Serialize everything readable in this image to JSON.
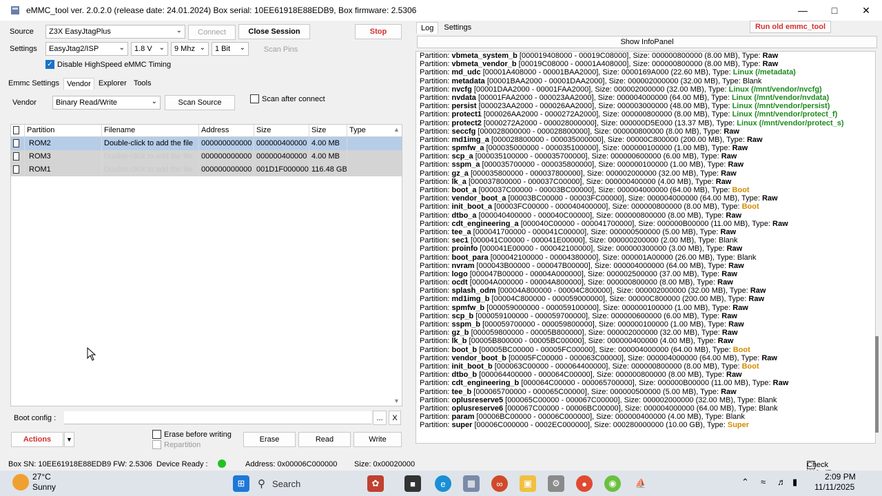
{
  "window": {
    "title": "eMMC_tool ver. 2.0.2.0 (release date: 24.01.2024) Box serial: 10EE61918E88EDB9, Box firmware: 2.5306"
  },
  "top": {
    "source_label": "Source",
    "source_value": "Z3X EasyJtagPlus",
    "connect": "Connect",
    "close_session": "Close Session",
    "stop": "Stop",
    "settings_label": "Settings",
    "settings_value": "EasyJtag2/ISP",
    "voltage": "1.8 V",
    "clock": "9 Mhz",
    "bus": "1 Bit",
    "scan_pins": "Scan Pins",
    "disable_hs": "Disable HighSpeed eMMC Timing"
  },
  "tabs": [
    "Emmc Settings",
    "Vendor",
    "Explorer",
    "Tools"
  ],
  "vendor": {
    "label": "Vendor",
    "value": "Binary Read/Write",
    "scan_source": "Scan Source",
    "scan_after": "Scan after connect"
  },
  "grid": {
    "headers": [
      "Partition",
      "Filename",
      "Address",
      "Size",
      "Size",
      "Type"
    ],
    "rows": [
      {
        "partition": "ROM2",
        "filename": "Double-click to add the file",
        "address": "000000000000",
        "size_hex": "000000400000",
        "size": "4.00 MB",
        "type": ""
      },
      {
        "partition": "ROM3",
        "filename": "Double-click to add the file",
        "address": "000000000000",
        "size_hex": "000000400000",
        "size": "4.00 MB",
        "type": ""
      },
      {
        "partition": "ROM1",
        "filename": "Double-click to add the file",
        "address": "000000000000",
        "size_hex": "001D1F000000",
        "size": "116.48 GB",
        "type": ""
      }
    ]
  },
  "boot": {
    "label": "Boot config  :",
    "browse": "...",
    "clear": "X"
  },
  "actions": {
    "actions": "Actions",
    "dropdown": "▼",
    "erase_before": "Erase before writing",
    "repartition": "Repartition",
    "erase": "Erase",
    "read": "Read",
    "write": "Write"
  },
  "right": {
    "tab_log": "Log",
    "tab_settings": "Settings",
    "run_old": "Run old emmc_tool",
    "show_info": "Show InfoPanel",
    "check_write": "Check Write/Erase"
  },
  "log_prefix": "Partition: ",
  "log": [
    {
      "name": "vbmeta_system_b",
      "range": "[000019408000 - 00019C08000]",
      "size": "000000800000 (8.00 MB)",
      "type": "Raw"
    },
    {
      "name": "vbmeta_vendor_b",
      "range": "[00019C08000 - 00001A408000]",
      "size": "000000800000 (8.00 MB)",
      "type": "Raw"
    },
    {
      "name": "md_udc",
      "range": "[00001A408000 - 00001BAA2000]",
      "size": "0000169A000 (22.60 MB)",
      "type": "Linux (/metadata)"
    },
    {
      "name": "metadata",
      "range": "[00001BAA2000 - 00001DAA2000]",
      "size": "000002000000 (32.00 MB)",
      "type": "Blank"
    },
    {
      "name": "nvcfg",
      "range": "[00001DAA2000 - 00001FAA2000]",
      "size": "000002000000 (32.00 MB)",
      "type": "Linux (/mnt/vendor/nvcfg)"
    },
    {
      "name": "nvdata",
      "range": "[00001FAA2000 - 000023AA2000]",
      "size": "000004000000 (64.00 MB)",
      "type": "Linux (/mnt/vendor/nvdata)"
    },
    {
      "name": "persist",
      "range": "[000023AA2000 - 000026AA2000]",
      "size": "000003000000 (48.00 MB)",
      "type": "Linux (/mnt/vendor/persist)"
    },
    {
      "name": "protect1",
      "range": "[000026AA2000 - 0000272A2000]",
      "size": "000000800000 (8.00 MB)",
      "type": "Linux (/mnt/vendor/protect_f)"
    },
    {
      "name": "protect2",
      "range": "[0000272A2000 - 000028000000]",
      "size": "000000D5E000 (13.37 MB)",
      "type": "Linux (/mnt/vendor/protect_s)"
    },
    {
      "name": "seccfg",
      "range": "[000028000000 - 000028800000]",
      "size": "000000800000 (8.00 MB)",
      "type": "Raw"
    },
    {
      "name": "md1img_a",
      "range": "[000028800000 - 000035000000]",
      "size": "00000C800000 (200.00 MB)",
      "type": "Raw"
    },
    {
      "name": "spmfw_a",
      "range": "[000035000000 - 000035100000]",
      "size": "000000100000 (1.00 MB)",
      "type": "Raw"
    },
    {
      "name": "scp_a",
      "range": "[000035100000 - 000035700000]",
      "size": "000000600000 (6.00 MB)",
      "type": "Raw"
    },
    {
      "name": "sspm_a",
      "range": "[000035700000 - 000035800000]",
      "size": "000000100000 (1.00 MB)",
      "type": "Raw"
    },
    {
      "name": "gz_a",
      "range": "[000035800000 - 000037800000]",
      "size": "000002000000 (32.00 MB)",
      "type": "Raw"
    },
    {
      "name": "lk_a",
      "range": "[000037800000 - 000037C00000]",
      "size": "000000400000 (4.00 MB)",
      "type": "Raw"
    },
    {
      "name": "boot_a",
      "range": "[000037C00000 - 00003BC00000]",
      "size": "000004000000 (64.00 MB)",
      "type": "Boot"
    },
    {
      "name": "vendor_boot_a",
      "range": "[00003BC00000 - 00003FC00000]",
      "size": "000004000000 (64.00 MB)",
      "type": "Raw"
    },
    {
      "name": "init_boot_a",
      "range": "[00003FC00000 - 000040400000]",
      "size": "000000800000 (8.00 MB)",
      "type": "Boot"
    },
    {
      "name": "dtbo_a",
      "range": "[000040400000 - 000040C00000]",
      "size": "000000800000 (8.00 MB)",
      "type": "Raw"
    },
    {
      "name": "cdt_engineering_a",
      "range": "[000040C00000 - 000041700000]",
      "size": "000000B00000 (11.00 MB)",
      "type": "Raw"
    },
    {
      "name": "tee_a",
      "range": "[000041700000 - 000041C00000]",
      "size": "000000500000 (5.00 MB)",
      "type": "Raw"
    },
    {
      "name": "sec1",
      "range": "[000041C00000 - 000041E00000]",
      "size": "000000200000 (2.00 MB)",
      "type": "Blank"
    },
    {
      "name": "proinfo",
      "range": "[000041E00000 - 000042100000]",
      "size": "000000300000 (3.00 MB)",
      "type": "Raw"
    },
    {
      "name": "boot_para",
      "range": "[000042100000 - 00004380000]",
      "size": "000001A00000 (26.00 MB)",
      "type": "Blank"
    },
    {
      "name": "nvram",
      "range": "[000043B00000 - 000047B00000]",
      "size": "000004000000 (64.00 MB)",
      "type": "Raw"
    },
    {
      "name": "logo",
      "range": "[000047B00000 - 00004A000000]",
      "size": "000002500000 (37.00 MB)",
      "type": "Raw"
    },
    {
      "name": "ocdt",
      "range": "[00004A000000 - 00004A800000]",
      "size": "000000800000 (8.00 MB)",
      "type": "Raw"
    },
    {
      "name": "splash_odm",
      "range": "[00004A800000 - 00004C800000]",
      "size": "000002000000 (32.00 MB)",
      "type": "Raw"
    },
    {
      "name": "md1img_b",
      "range": "[00004C800000 - 000059000000]",
      "size": "00000C800000 (200.00 MB)",
      "type": "Raw"
    },
    {
      "name": "spmfw_b",
      "range": "[000059000000 - 000059100000]",
      "size": "000000100000 (1.00 MB)",
      "type": "Raw"
    },
    {
      "name": "scp_b",
      "range": "[000059100000 - 000059700000]",
      "size": "000000600000 (6.00 MB)",
      "type": "Raw"
    },
    {
      "name": "sspm_b",
      "range": "[000059700000 - 000059800000]",
      "size": "000000100000 (1.00 MB)",
      "type": "Raw"
    },
    {
      "name": "gz_b",
      "range": "[000059800000 - 00005B800000]",
      "size": "000002000000 (32.00 MB)",
      "type": "Raw"
    },
    {
      "name": "lk_b",
      "range": "[00005B800000 - 00005BC00000]",
      "size": "000000400000 (4.00 MB)",
      "type": "Raw"
    },
    {
      "name": "boot_b",
      "range": "[00005BC00000 - 00005FC00000]",
      "size": "000004000000 (64.00 MB)",
      "type": "Boot"
    },
    {
      "name": "vendor_boot_b",
      "range": "[00005FC00000 - 000063C00000]",
      "size": "000004000000 (64.00 MB)",
      "type": "Raw"
    },
    {
      "name": "init_boot_b",
      "range": "[000063C00000 - 000064400000]",
      "size": "000000800000 (8.00 MB)",
      "type": "Boot"
    },
    {
      "name": "dtbo_b",
      "range": "[000064400000 - 000064C00000]",
      "size": "000000800000 (8.00 MB)",
      "type": "Raw"
    },
    {
      "name": "cdt_engineering_b",
      "range": "[000064C00000 - 000065700000]",
      "size": "000000B00000 (11.00 MB)",
      "type": "Raw"
    },
    {
      "name": "tee_b",
      "range": "[000065700000 - 000065C00000]",
      "size": "000000500000 (5.00 MB)",
      "type": "Raw"
    },
    {
      "name": "oplusreserve5",
      "range": "[000065C00000 - 000067C00000]",
      "size": "000002000000 (32.00 MB)",
      "type": "Blank"
    },
    {
      "name": "oplusreserve6",
      "range": "[000067C00000 - 00006BC00000]",
      "size": "000004000000 (64.00 MB)",
      "type": "Blank"
    },
    {
      "name": "param",
      "range": "[00006BC00000 - 00006C000000]",
      "size": "000000400000 (4.00 MB)",
      "type": "Blank"
    },
    {
      "name": "super",
      "range": "[00006C000000 - 0002EC000000]",
      "size": "000280000000 (10.00 GB)",
      "type": "Super"
    }
  ],
  "status": {
    "box_sn": "Box SN:  10EE61918E88EDB9   FW:  2.5306",
    "device_ready": "Device Ready :",
    "address": "Address: 0x00006C000000",
    "size": "Size: 0x00020000"
  },
  "taskbar": {
    "temp": "27°C",
    "weather": "Sunny",
    "search": "Search",
    "time": "2:09 PM",
    "date": "11/11/2025"
  },
  "colors": {
    "linux": "#1e8a1e",
    "boot": "#d48a00",
    "super": "#d48a00",
    "stop": "#d32f2f"
  }
}
